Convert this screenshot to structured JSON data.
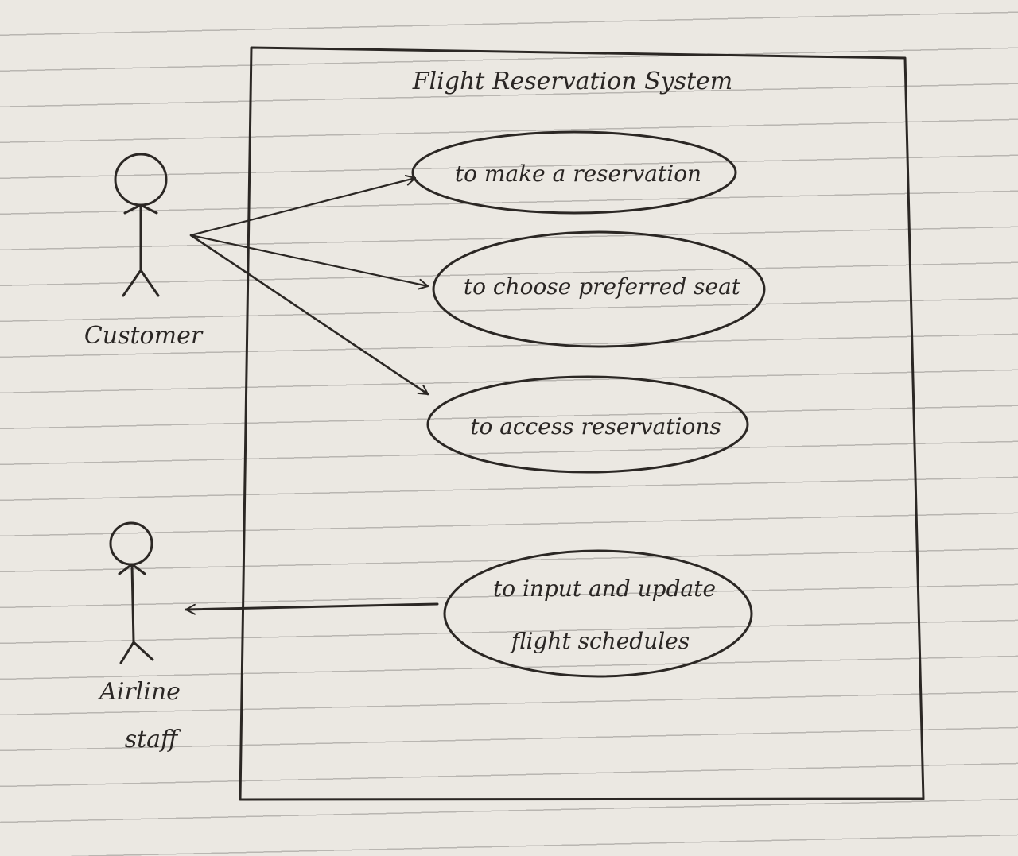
{
  "diagram": {
    "system_title": "Flight Reservation System",
    "actors": [
      {
        "id": "customer",
        "label_lines": [
          "Customer"
        ]
      },
      {
        "id": "airline-staff",
        "label_lines": [
          "Airline",
          "staff"
        ]
      }
    ],
    "use_cases": [
      {
        "id": "make-reservation",
        "label_lines": [
          "to make a reservation"
        ]
      },
      {
        "id": "choose-seat",
        "label_lines": [
          "to choose preferred seat"
        ]
      },
      {
        "id": "access-reservations",
        "label_lines": [
          "to access reservations"
        ]
      },
      {
        "id": "update-schedules",
        "label_lines": [
          "to input and update",
          "flight schedules"
        ]
      }
    ],
    "associations": [
      {
        "from": "customer",
        "to": "make-reservation"
      },
      {
        "from": "customer",
        "to": "choose-seat"
      },
      {
        "from": "customer",
        "to": "access-reservations"
      },
      {
        "from": "update-schedules",
        "to": "airline-staff"
      }
    ],
    "colors": {
      "ink": "#2b2724",
      "paper": "#ebe8e2",
      "ruled_line": "#b9b6b1"
    }
  }
}
